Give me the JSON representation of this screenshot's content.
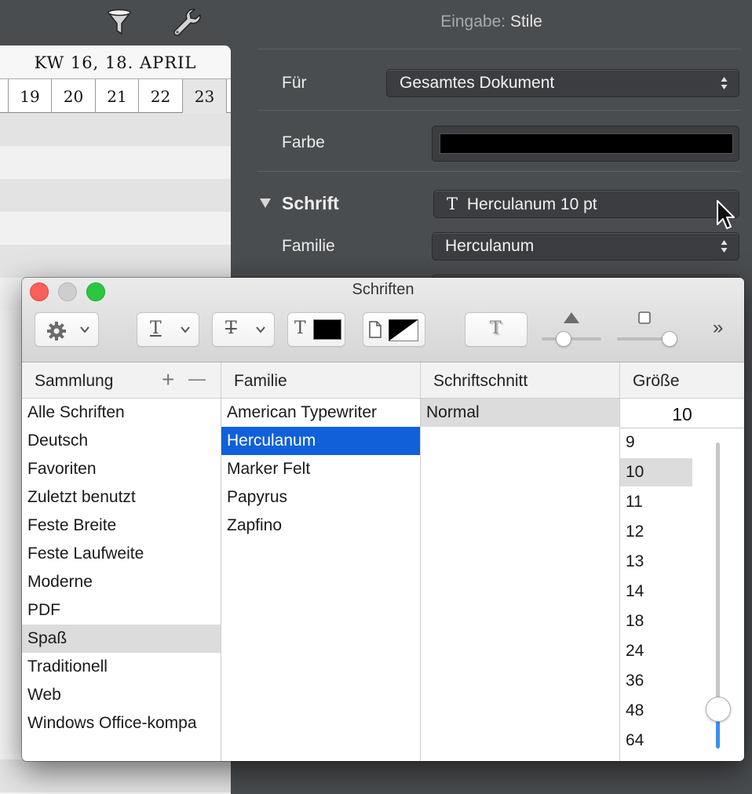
{
  "calendar": {
    "week_label": "KW 16, 18. APRIL",
    "days": [
      "19",
      "20",
      "21",
      "22",
      "23"
    ]
  },
  "inspector": {
    "header_label": "Eingabe:",
    "header_value": "Stile",
    "fuer_label": "Für",
    "fuer_value": "Gesamtes Dokument",
    "farbe_label": "Farbe",
    "farbe_color": "#000000",
    "schrift_label": "Schrift",
    "schrift_glyph": "T",
    "schrift_value": "Herculanum 10 pt",
    "familie_label": "Familie",
    "familie_value": "Herculanum"
  },
  "fonts_panel": {
    "title": "Schriften",
    "toolbar": {
      "underline_glyph": "T",
      "strike_glyph": "T",
      "text_color_glyph": "T",
      "text_color": "#000000",
      "shadow_glyph": "T",
      "more": "»"
    },
    "columns": {
      "sammlung": "Sammlung",
      "familie": "Familie",
      "schriftschnitt": "Schriftschnitt",
      "groesse": "Größe",
      "add": "+",
      "remove": "—"
    },
    "collections": [
      "Alle Schriften",
      "Deutsch",
      "Favoriten",
      "Zuletzt benutzt",
      "Feste Breite",
      "Feste Laufweite",
      "Moderne",
      "PDF",
      "Spaß",
      "Traditionell",
      "Web",
      "Windows Office-kompa"
    ],
    "selected_collection": "Spaß",
    "families": [
      "American Typewriter",
      "Herculanum",
      "Marker Felt",
      "Papyrus",
      "Zapfino"
    ],
    "selected_family": "Herculanum",
    "typefaces": [
      "Normal"
    ],
    "selected_typeface": "Normal",
    "size_value": "10",
    "sizes": [
      "9",
      "10",
      "11",
      "12",
      "13",
      "14",
      "18",
      "24",
      "36",
      "48",
      "64"
    ],
    "selected_size": "10"
  }
}
